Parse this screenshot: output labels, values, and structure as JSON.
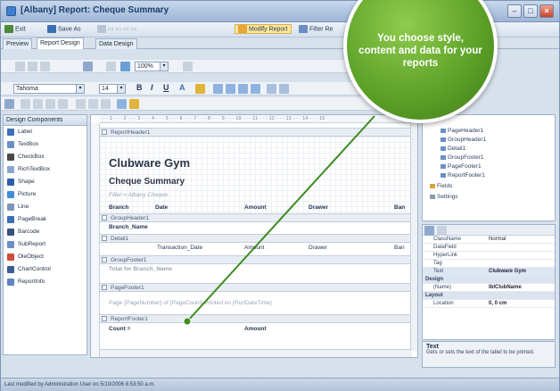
{
  "window": {
    "title": "[Albany] Report: Cheque Summary"
  },
  "toolbar": {
    "items": [
      "Exit",
      "Save As",
      "Modify Report",
      "Filter Re"
    ]
  },
  "tabs": [
    "Preview",
    "Report Design",
    "Data Design"
  ],
  "format_bar": {
    "font": "Tahoma",
    "zoom": "100%",
    "font_size": "14"
  },
  "design_components": {
    "header": "Design Components",
    "items": [
      "Label",
      "TextBox",
      "CheckBox",
      "RichTextBox",
      "Shape",
      "Picture",
      "Line",
      "PageBreak",
      "Barcode",
      "SubReport",
      "OleObject",
      "ChartControl",
      "ReportInfo"
    ]
  },
  "report": {
    "report_header": "ReportHeader1",
    "gym_name": "Clubware Gym",
    "report_title": "Cheque Summary",
    "filter_text": "Filter = Albany Cheque",
    "columns": [
      "Branch",
      "Date",
      "Amount",
      "Drawer",
      "Ban"
    ],
    "group_header": "GroupHeader1",
    "branch_field": "Branch_Name",
    "detail": "Detail1",
    "detail_fields": [
      "Transaction_Date",
      "Amount",
      "Drawer",
      "Ban"
    ],
    "group_footer": "GroupFooter1",
    "group_total": "Total for Branch_Name",
    "page_footer": "PageFooter1",
    "page_footer_text": "Page {PageNumber} of {PageCount} Printed on {RunDateTime}",
    "report_footer": "ReportFooter1",
    "count_label": "Count =",
    "amount_label": "Amount"
  },
  "tree": {
    "items": [
      "PageHeader1",
      "GroupHeader1",
      "Detail1",
      "GroupFooter1",
      "PageFooter1",
      "ReportFooter1",
      "Fields",
      "Settings"
    ]
  },
  "properties": {
    "rows": [
      {
        "name": "ClassName",
        "value": "Normal"
      },
      {
        "name": "DataField",
        "value": ""
      },
      {
        "name": "HyperLink",
        "value": ""
      },
      {
        "name": "Tag",
        "value": ""
      },
      {
        "name": "Text",
        "value": "Clubware Gym"
      }
    ],
    "design_category": "Design",
    "name_row": {
      "name": "(Name)",
      "value": "lblClubName"
    },
    "layout_category": "Layout",
    "location_row": {
      "name": "Location",
      "value": "0, 0 cm"
    }
  },
  "description": {
    "title": "Text",
    "text": "Gets or sets the text of the label to be printed."
  },
  "status": "Last modified by Administration User on 5/10/2006 8:53:50 a.m.",
  "callout": {
    "text": "You choose style, content and data for your reports"
  },
  "colors": {
    "callout_green": "#5a9f27",
    "pointer_line": "#3d8c1f",
    "titlebar": "#9db6d6"
  }
}
